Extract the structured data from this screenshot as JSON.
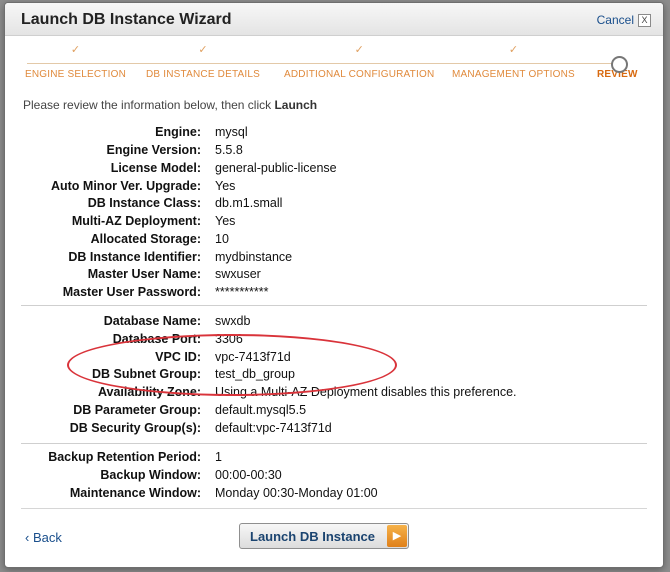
{
  "dialog": {
    "title": "Launch DB Instance Wizard",
    "cancel_label": "Cancel",
    "close_glyph": "X"
  },
  "steps": [
    {
      "label": "ENGINE SELECTION",
      "check": "✓"
    },
    {
      "label": "DB INSTANCE DETAILS",
      "check": "✓"
    },
    {
      "label": "ADDITIONAL CONFIGURATION",
      "check": "✓"
    },
    {
      "label": "MANAGEMENT OPTIONS",
      "check": "✓"
    },
    {
      "label": "REVIEW",
      "check": ""
    }
  ],
  "instruction": {
    "text": "Please review the information below, then click ",
    "action": "Launch"
  },
  "section1": [
    {
      "label": "Engine:",
      "value": "mysql"
    },
    {
      "label": "Engine Version:",
      "value": "5.5.8"
    },
    {
      "label": "License Model:",
      "value": "general-public-license"
    },
    {
      "label": "Auto Minor Ver. Upgrade:",
      "value": "Yes"
    },
    {
      "label": "DB Instance Class:",
      "value": "db.m1.small"
    },
    {
      "label": "Multi-AZ Deployment:",
      "value": "Yes"
    },
    {
      "label": "Allocated Storage:",
      "value": "10"
    },
    {
      "label": "DB Instance Identifier:",
      "value": "mydbinstance"
    },
    {
      "label": "Master User Name:",
      "value": "swxuser"
    },
    {
      "label": "Master User Password:",
      "value": "***********"
    }
  ],
  "section2": [
    {
      "label": "Database Name:",
      "value": "swxdb"
    },
    {
      "label": "Database Port:",
      "value": "3306"
    },
    {
      "label": "VPC ID:",
      "value": "vpc-7413f71d"
    },
    {
      "label": "DB Subnet Group:",
      "value": "test_db_group"
    },
    {
      "label": "Availability Zone:",
      "value": "Using a Multi-AZ Deployment disables this preference."
    },
    {
      "label": "DB Parameter Group:",
      "value": "default.mysql5.5"
    },
    {
      "label": "DB Security Group(s):",
      "value": "default:vpc-7413f71d"
    }
  ],
  "section3": [
    {
      "label": "Backup Retention Period:",
      "value": "1"
    },
    {
      "label": "Backup Window:",
      "value": "00:00-00:30"
    },
    {
      "label": "Maintenance Window:",
      "value": "Monday 00:30-Monday 01:00"
    }
  ],
  "footer": {
    "back_label": "Back",
    "back_glyph": "‹",
    "launch_label": "Launch DB Instance",
    "launch_glyph": "▶"
  },
  "colors": {
    "step_accent": "#e08a3c",
    "highlight_ellipse": "#d9333a",
    "link": "#1a4f8c"
  }
}
